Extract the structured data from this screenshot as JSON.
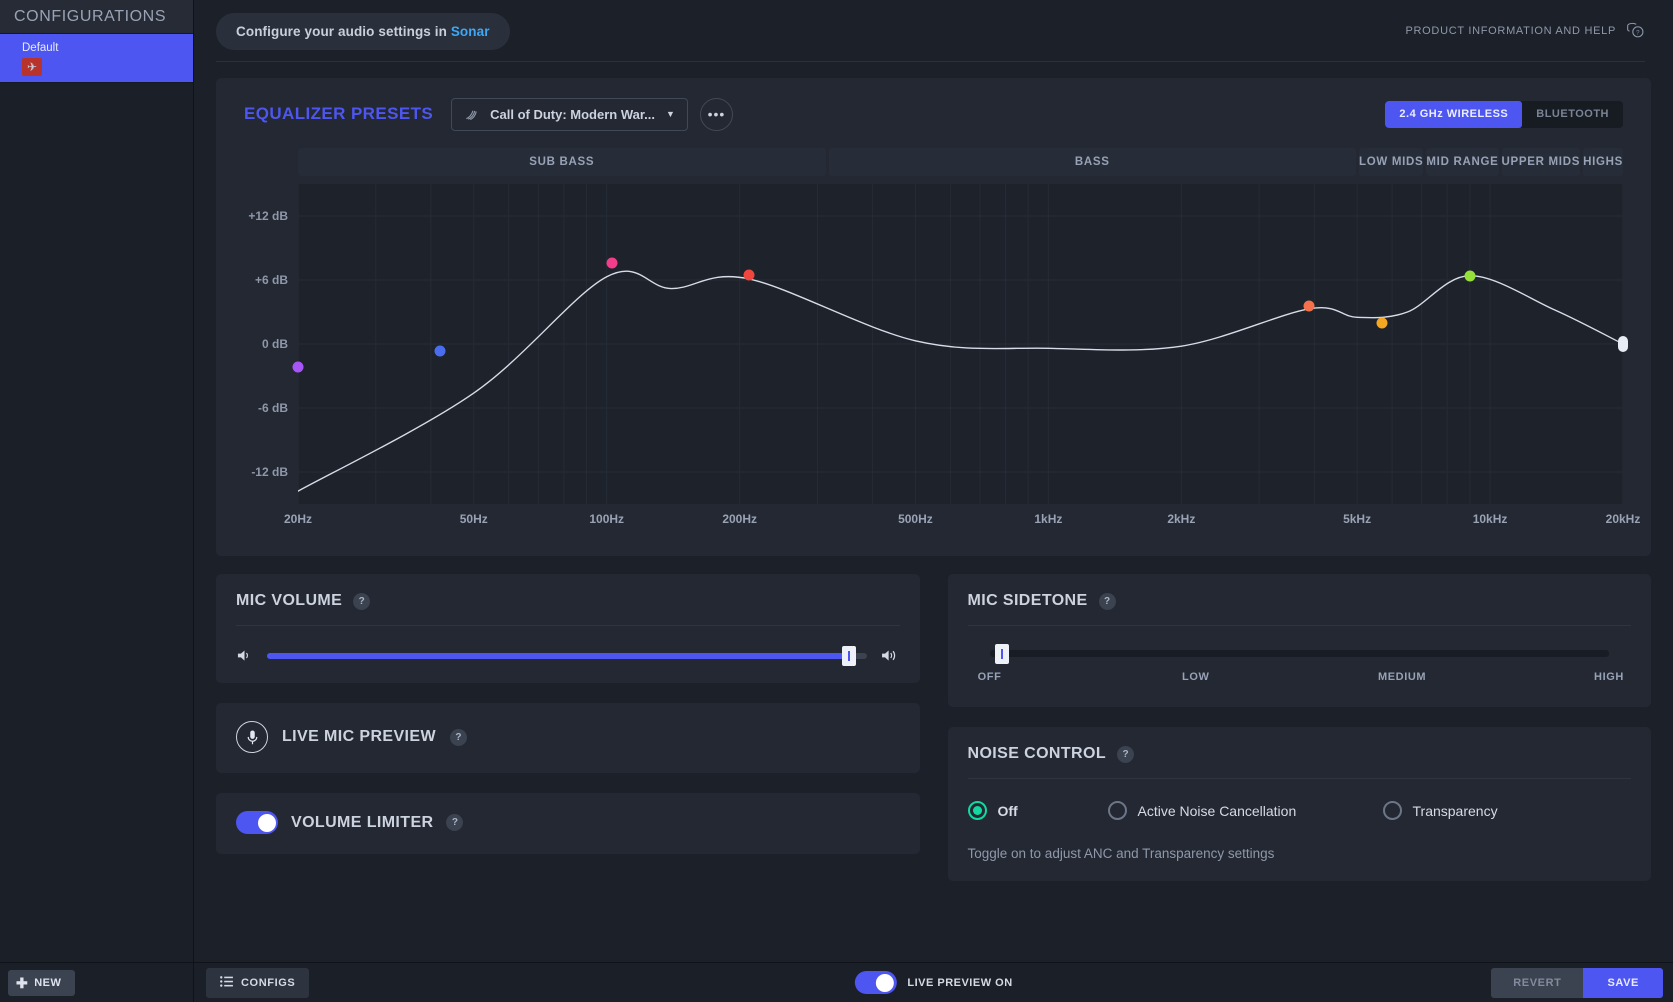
{
  "sidebar": {
    "header": "CONFIGURATIONS",
    "items": [
      {
        "label": "Default",
        "thumb_icon": "jet-icon"
      }
    ],
    "new_button": "NEW"
  },
  "topbar": {
    "sonar_pill_prefix": "Configure your audio settings in ",
    "sonar_pill_link": "Sonar",
    "help_label": "PRODUCT INFORMATION AND HELP",
    "help_icon": "chat-question-icon"
  },
  "equalizer": {
    "title": "EQUALIZER PRESETS",
    "preset_icon": "preset-wave-icon",
    "preset_selected": "Call of Duty: Modern War...",
    "more_button": "•••",
    "connection": {
      "options": [
        "2.4 GHz WIRELESS",
        "BLUETOOTH"
      ],
      "selected": "2.4 GHz WIRELESS"
    },
    "bands": [
      "SUB BASS",
      "BASS",
      "LOW MIDS",
      "MID RANGE",
      "UPPER MIDS",
      "HIGHS"
    ]
  },
  "chart_data": {
    "type": "line",
    "title": "EQUALIZER PRESETS",
    "xlabel": "",
    "ylabel": "dB",
    "ylim": [
      -15,
      15
    ],
    "y_ticks": [
      12,
      6,
      0,
      -6,
      -12
    ],
    "y_tick_labels": [
      "+12 dB",
      "+6 dB",
      "0 dB",
      "-6 dB",
      "-12 dB"
    ],
    "x_ticks": [
      20,
      50,
      100,
      200,
      500,
      1000,
      2000,
      5000,
      10000,
      20000
    ],
    "x_tick_labels": [
      "20Hz",
      "50Hz",
      "100Hz",
      "200Hz",
      "500Hz",
      "1kHz",
      "2kHz",
      "5kHz",
      "10kHz",
      "20kHz"
    ],
    "grid": true,
    "line_color": "#d7dce8",
    "control_points": [
      {
        "name": "band-1",
        "freq_hz": 20,
        "gain_db": -2.2,
        "color": "#a855f7"
      },
      {
        "name": "band-2",
        "freq_hz": 42,
        "gain_db": -0.7,
        "color": "#4a6df0"
      },
      {
        "name": "band-3",
        "freq_hz": 103,
        "gain_db": 7.6,
        "color": "#f23d8a"
      },
      {
        "name": "band-4",
        "freq_hz": 210,
        "gain_db": 6.5,
        "color": "#f0463d"
      },
      {
        "name": "band-5",
        "freq_hz": 3900,
        "gain_db": 3.6,
        "color": "#f4724b"
      },
      {
        "name": "band-6",
        "freq_hz": 5700,
        "gain_db": 2.0,
        "color": "#f5a623"
      },
      {
        "name": "band-7",
        "freq_hz": 9000,
        "gain_db": 6.4,
        "color": "#96e03a"
      },
      {
        "name": "band-8",
        "freq_hz": 20000,
        "gain_db": 0.0,
        "color": "#e8ecf5"
      }
    ],
    "curve_db_at": {
      "20": -13.8,
      "50": -4.6,
      "100": 6.3,
      "140": 5.2,
      "210": 6.1,
      "500": 0.3,
      "1000": -0.4,
      "2000": -0.2,
      "3900": 3.3,
      "5000": 2.5,
      "6500": 3.0,
      "9000": 6.4,
      "14000": 3.2,
      "20000": 0.0
    }
  },
  "mic_volume": {
    "title": "MIC VOLUME",
    "help": "?",
    "icon_left": "speaker-low-icon",
    "icon_right": "speaker-high-icon",
    "value_percent": 97
  },
  "mic_sidetone": {
    "title": "MIC SIDETONE",
    "help": "?",
    "value_percent": 2,
    "scale_labels": [
      "OFF",
      "LOW",
      "MEDIUM",
      "HIGH"
    ]
  },
  "live_mic_preview": {
    "title": "LIVE MIC PREVIEW",
    "help": "?",
    "icon": "microphone-icon"
  },
  "volume_limiter": {
    "title": "VOLUME LIMITER",
    "help": "?",
    "enabled": true
  },
  "noise_control": {
    "title": "NOISE CONTROL",
    "help": "?",
    "options": [
      {
        "label": "Off",
        "selected": true
      },
      {
        "label": "Active Noise Cancellation",
        "selected": false
      },
      {
        "label": "Transparency",
        "selected": false
      }
    ],
    "hint": "Toggle on to adjust ANC and Transparency settings"
  },
  "footer": {
    "configs_label": "CONFIGS",
    "configs_icon": "list-icon",
    "live_preview_label": "LIVE PREVIEW ON",
    "live_preview_on": true,
    "revert_label": "REVERT",
    "save_label": "SAVE"
  },
  "colors": {
    "accent": "#4d56f0",
    "link": "#3ea8f5",
    "radio_on": "#12d9a0",
    "panel": "#232832",
    "bg": "#1c2029"
  }
}
